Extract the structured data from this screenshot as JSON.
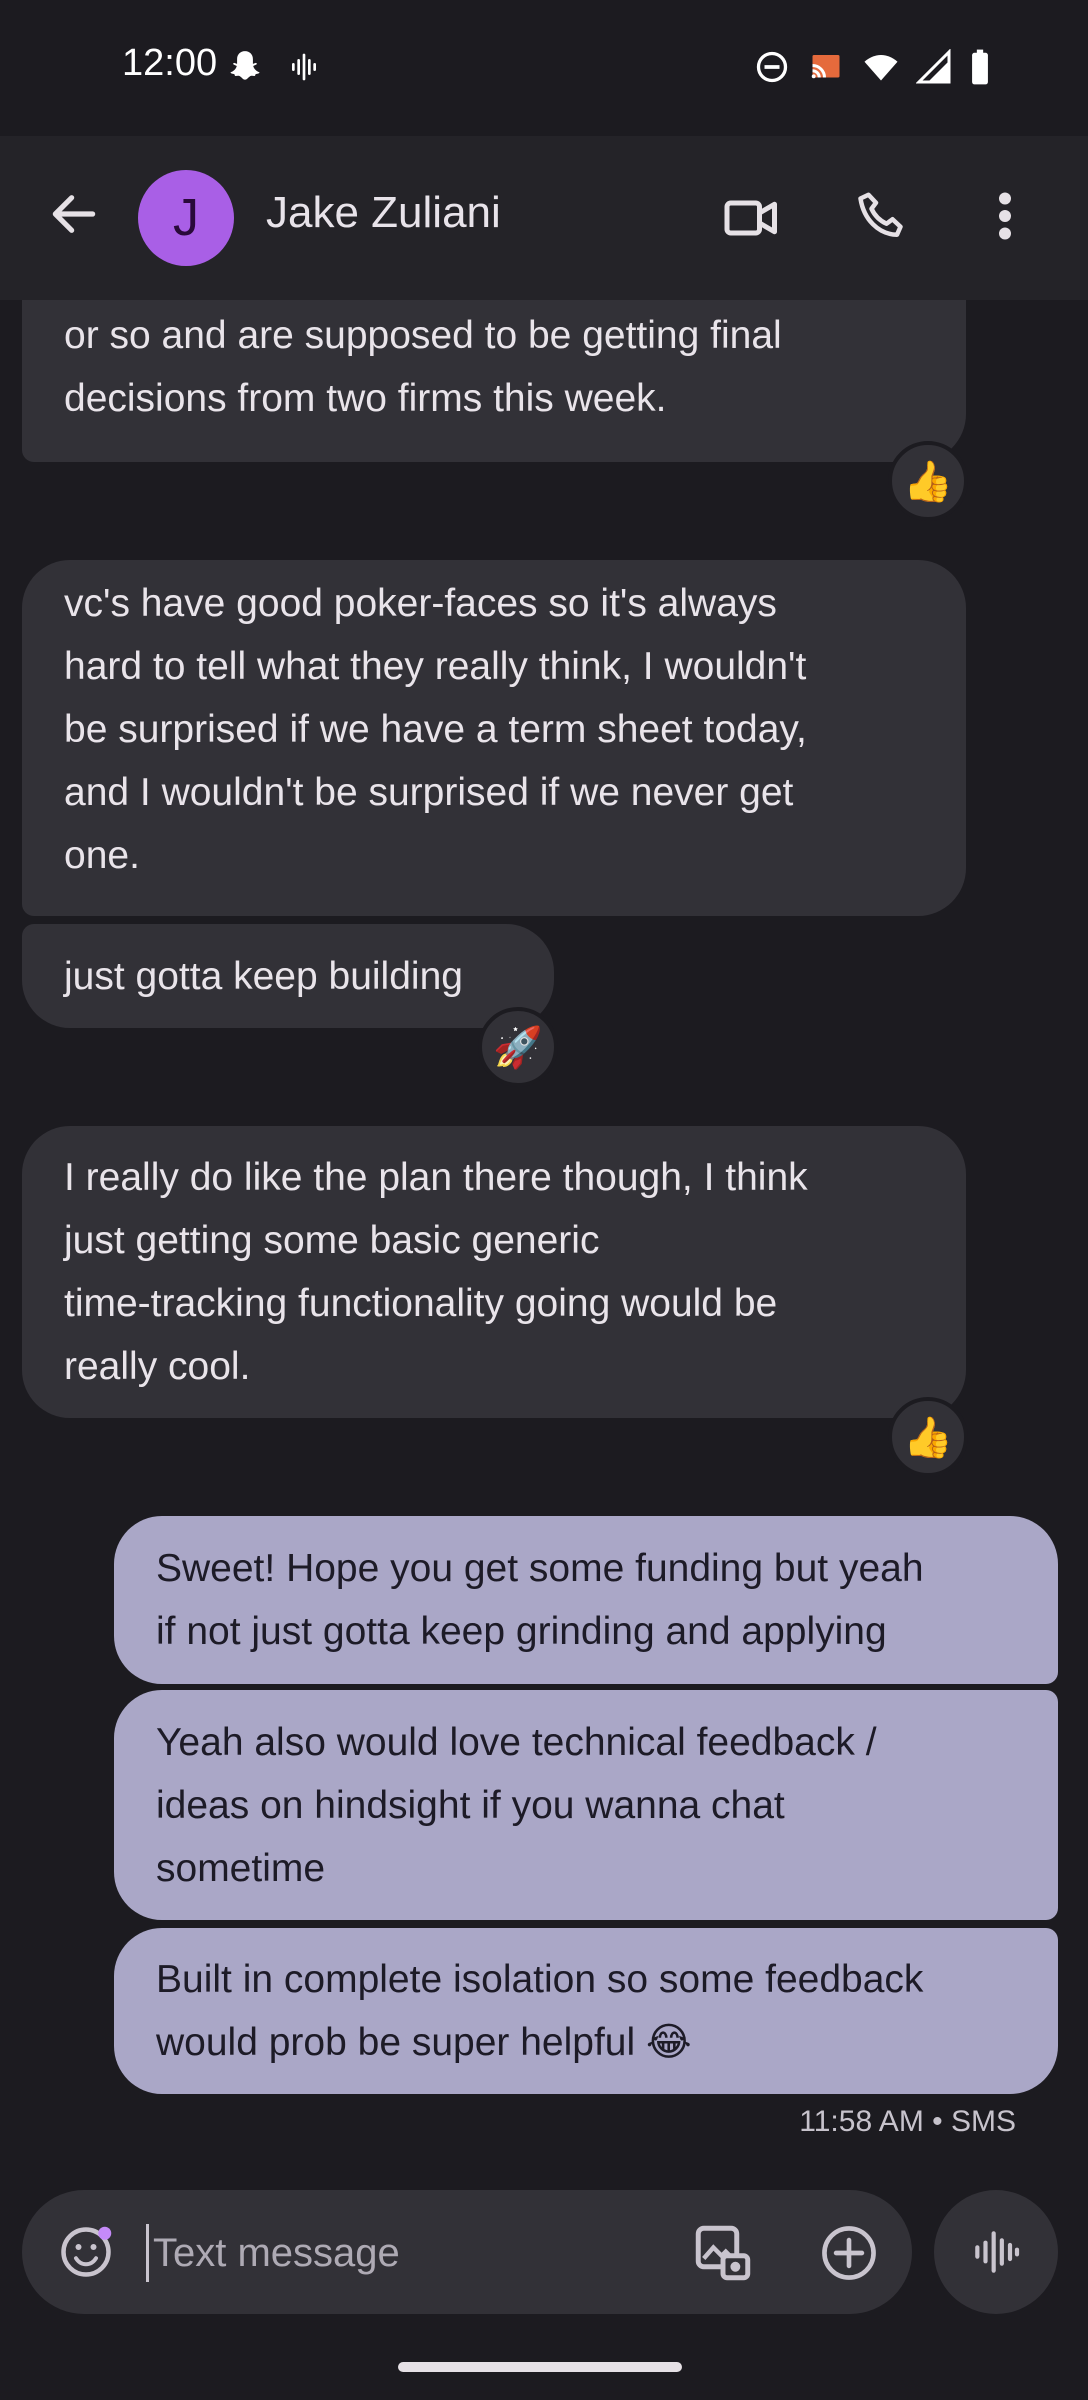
{
  "status_bar": {
    "time": "12:00"
  },
  "app_bar": {
    "avatar_letter": "J",
    "contact_name": "Jake Zuliani"
  },
  "messages": {
    "m1_line1": "or so and are supposed to be getting final",
    "m1_line2": "decisions from two firms this week.",
    "m1_reaction": "👍",
    "m2_line1": "vc's have good poker-faces so it's always",
    "m2_line2": "hard to tell what they really think, I wouldn't",
    "m2_line3": "be surprised if we have a term sheet today,",
    "m2_line4": "and I wouldn't be surprised if we never get",
    "m2_line5": "one.",
    "m3_text": "just gotta keep building",
    "m3_reaction": "🚀",
    "m4_line1": "I really do like the plan there though, I think",
    "m4_line2": "just getting some basic generic",
    "m4_line3": "time-tracking functionality going would be",
    "m4_line4": "really cool.",
    "m4_reaction": "👍",
    "m5_line1": "Sweet! Hope you get some funding but yeah",
    "m5_line2": "if not just gotta keep grinding and applying",
    "m6_line1": "Yeah also would love technical feedback /",
    "m6_line2": "ideas on hindsight if you wanna chat",
    "m6_line3": "sometime",
    "m7_line1": "Built in complete isolation so some feedback",
    "m7_line2": "would prob be super helpful 😂",
    "timestamp": "11:58 AM • SMS"
  },
  "compose": {
    "placeholder": "Text message"
  }
}
